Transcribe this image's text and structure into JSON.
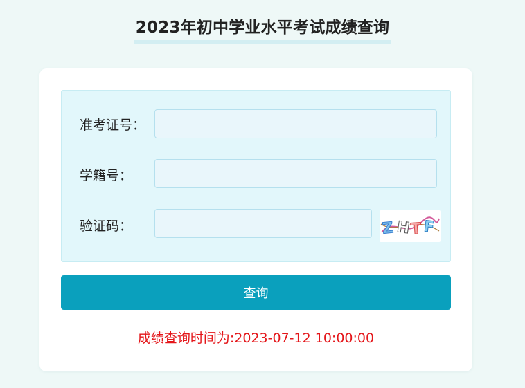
{
  "page": {
    "title": "2023年初中学业水平考试成绩查询"
  },
  "form": {
    "exam_number": {
      "label": "准考证号：",
      "value": "",
      "placeholder": ""
    },
    "student_id": {
      "label": "学籍号：",
      "value": "",
      "placeholder": ""
    },
    "captcha": {
      "label": "验证码：",
      "value": "",
      "placeholder": "",
      "image_text": "ZHTF"
    },
    "submit_label": "查询"
  },
  "notice": {
    "text": "成绩查询时间为:2023-07-12 10:00:00"
  },
  "colors": {
    "background": "#eef8f7",
    "panel": "#e2f7fb",
    "button": "#0aa0bd",
    "notice": "#e4161a"
  }
}
